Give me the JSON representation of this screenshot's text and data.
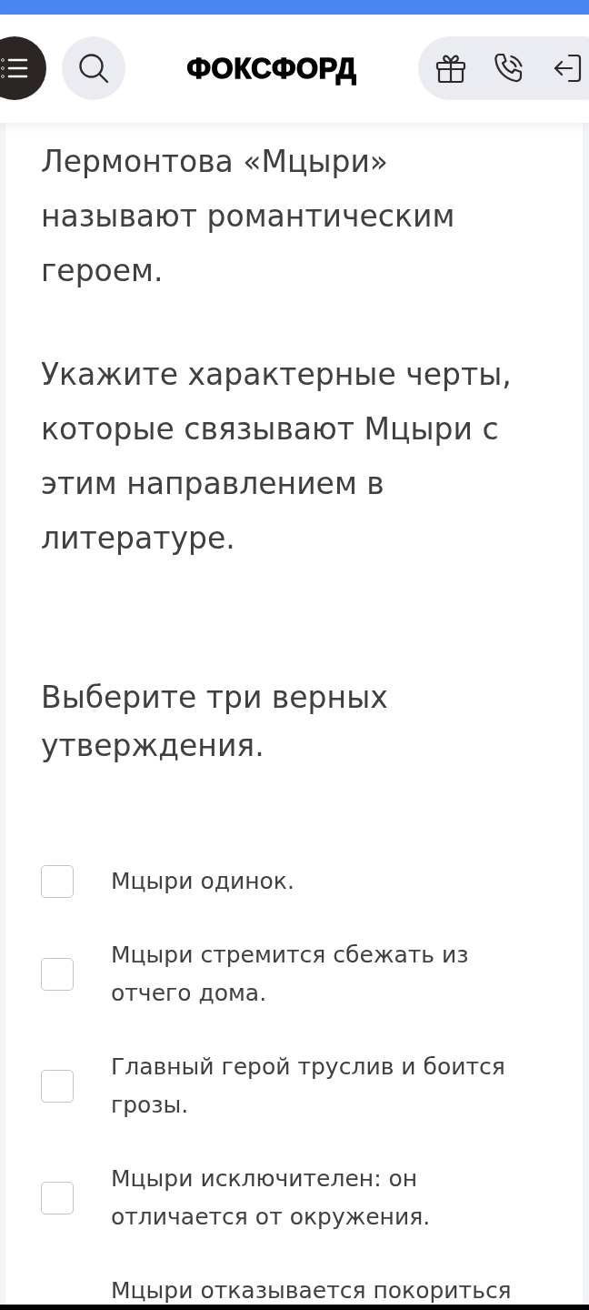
{
  "header": {
    "logo": "ФОКСФОРД"
  },
  "question": {
    "paragraphs": [
      "Лермонтова «Мцыри» называют романтическим героем.",
      "Укажите характерные черты, которые связывают Мцыри с этим направлением в литературе."
    ],
    "instruction": "Выберите три верных утверждения.",
    "options": [
      {
        "text": "Мцыри одинок.",
        "checked": false
      },
      {
        "text": "Мцыри стремится сбежать из отчего дома.",
        "checked": false
      },
      {
        "text": "Главный герой труслив и боится грозы.",
        "checked": false
      },
      {
        "text": "Мцыри исключителен: он отличается от окружения.",
        "checked": false
      },
      {
        "text": "Мцыри отказывается покориться"
      }
    ]
  }
}
